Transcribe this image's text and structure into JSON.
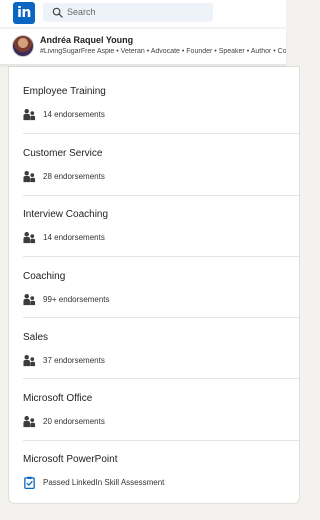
{
  "header": {
    "logo_text": "in",
    "search_placeholder": "Search"
  },
  "profile": {
    "name": "Andréa Raquel Young",
    "tagline": "#LivingSugarFree Aspie • Veteran • Advocate • Founder • Speaker • Author • Coach"
  },
  "skills": [
    {
      "name": "Employee Training",
      "detail": "14 endorsements",
      "icon": "people-icon"
    },
    {
      "name": "Customer Service",
      "detail": "28 endorsements",
      "icon": "people-icon"
    },
    {
      "name": "Interview Coaching",
      "detail": "14 endorsements",
      "icon": "people-icon"
    },
    {
      "name": "Coaching",
      "detail": "99+ endorsements",
      "icon": "people-icon"
    },
    {
      "name": "Sales",
      "detail": "37 endorsements",
      "icon": "people-icon"
    },
    {
      "name": "Microsoft Office",
      "detail": "20 endorsements",
      "icon": "people-icon"
    },
    {
      "name": "Microsoft PowerPoint",
      "detail": "Passed LinkedIn Skill Assessment",
      "icon": "assessment-clipboard-icon"
    }
  ],
  "colors": {
    "brand": "#0a66c2",
    "background": "#f4f2ee",
    "card": "#ffffff"
  }
}
